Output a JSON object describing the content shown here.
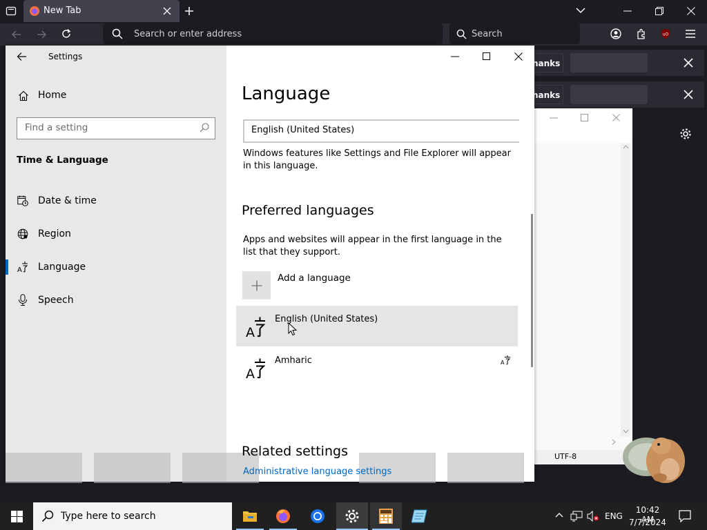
{
  "firefox": {
    "tab_title": "New Tab",
    "url_placeholder": "Search or enter address",
    "search_placeholder": "Search"
  },
  "notifications": [
    {
      "button_label": "hanks"
    },
    {
      "button_label": "hanks"
    }
  ],
  "background_window": {
    "encoding": "UTF-8"
  },
  "settings": {
    "window_title": "Settings",
    "home_label": "Home",
    "search_placeholder": "Find a setting",
    "section_heading": "Time & Language",
    "nav_items": [
      {
        "label": "Date & time",
        "icon": "date-time-icon"
      },
      {
        "label": "Region",
        "icon": "globe-icon"
      },
      {
        "label": "Language",
        "icon": "language-icon",
        "active": true
      },
      {
        "label": "Speech",
        "icon": "microphone-icon"
      }
    ],
    "page": {
      "title": "Language",
      "display_language_value": "English (United States)",
      "display_language_desc": "Windows features like Settings and File Explorer will appear in this language.",
      "preferred_heading": "Preferred languages",
      "preferred_desc": "Apps and websites will appear in the first language in the list that they support.",
      "add_language_label": "Add a language",
      "languages": [
        "English (United States)",
        "Amharic"
      ],
      "related_heading": "Related settings",
      "admin_link": "Administrative language settings"
    }
  },
  "taskbar": {
    "search_placeholder": "Type here to search",
    "apps": [
      "file-explorer",
      "firefox",
      "chrome",
      "settings",
      "calculator",
      "notepad"
    ],
    "tray_language": "ENG",
    "time": "10:42 AM",
    "date": "7/7/2024"
  },
  "colors": {
    "accent": "#0067c0",
    "firefox_dark": "#1c1b22",
    "sidebar_bg": "#e8e8e8",
    "taskbar": "#202020"
  }
}
